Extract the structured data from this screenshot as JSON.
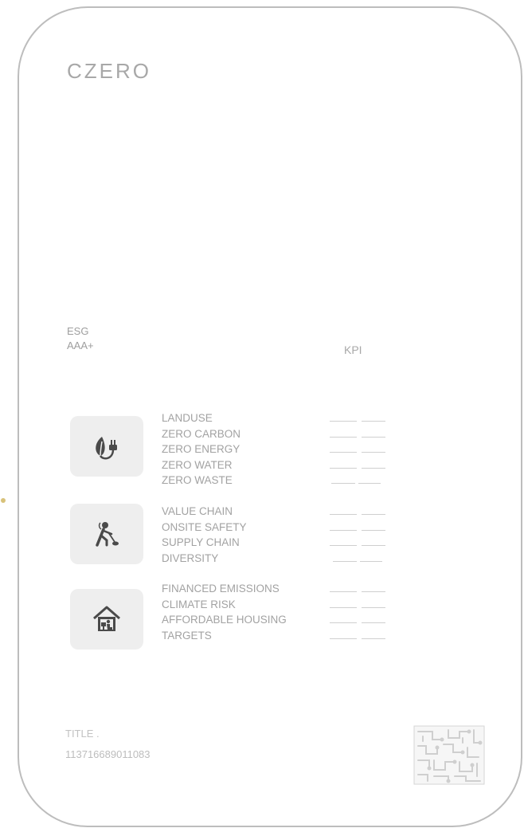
{
  "brand": {
    "name": "CZERO"
  },
  "rating": {
    "label": "ESG",
    "value": "AAA+"
  },
  "kpi_header": "KPI",
  "groups": [
    {
      "icon": "leaf-plug-icon",
      "items": [
        "LANDUSE",
        "ZERO CARBON",
        "ZERO ENERGY",
        "ZERO WATER",
        "ZERO WASTE"
      ]
    },
    {
      "icon": "worker-shovel-icon",
      "items": [
        "VALUE CHAIN",
        "ONSITE SAFETY",
        "SUPPLY CHAIN",
        "DIVERSITY"
      ]
    },
    {
      "icon": "house-person-icon",
      "items": [
        "FINANCED EMISSIONS",
        "CLIMATE RISK",
        "AFFORDABLE HOUSING",
        "TARGETS"
      ]
    }
  ],
  "footer": {
    "title_label": "TITLE .",
    "serial": "113716689011083"
  },
  "colors": {
    "text": "#9a9a9a",
    "border": "#bdbdbd",
    "tile": "#eeeeee",
    "icon": "#555555"
  }
}
